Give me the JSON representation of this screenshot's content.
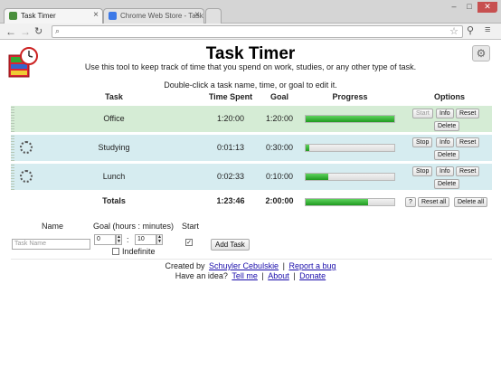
{
  "browser": {
    "tabs": [
      {
        "label": "Task Timer",
        "active": true
      },
      {
        "label": "Chrome Web Store - Task",
        "active": false
      }
    ],
    "address": ""
  },
  "page": {
    "title": "Task Timer",
    "subtitle": "Use this tool to keep track of time that you spend on work, studies, or any other type of task.",
    "hint": "Double-click a task name, time, or goal to edit it."
  },
  "columns": {
    "task": "Task",
    "time_spent": "Time Spent",
    "goal": "Goal",
    "progress": "Progress",
    "options": "Options"
  },
  "tasks": [
    {
      "name": "Office",
      "time": "1:20:00",
      "goal": "1:20:00",
      "progress": 1.0,
      "running": false,
      "btn_start": "Start",
      "btn_info": "Info",
      "btn_reset": "Reset",
      "btn_delete": "Delete"
    },
    {
      "name": "Studying",
      "time": "0:01:13",
      "goal": "0:30:00",
      "progress": 0.04,
      "running": true,
      "btn_start": "Stop",
      "btn_info": "Info",
      "btn_reset": "Reset",
      "btn_delete": "Delete"
    },
    {
      "name": "Lunch",
      "time": "0:02:33",
      "goal": "0:10:00",
      "progress": 0.25,
      "running": true,
      "btn_start": "Stop",
      "btn_info": "Info",
      "btn_reset": "Reset",
      "btn_delete": "Delete"
    }
  ],
  "totals": {
    "label": "Totals",
    "time": "1:23:46",
    "goal": "2:00:00",
    "progress": 0.7,
    "btn_help": "?",
    "btn_reset_all": "Reset all",
    "btn_delete_all": "Delete all"
  },
  "form": {
    "name_label": "Name",
    "goal_label": "Goal (hours : minutes)",
    "start_label": "Start",
    "name_placeholder": "Task Name",
    "hours": "0",
    "colon": ":",
    "minutes": "10",
    "indefinite_label": "Indefinite",
    "start_checked": true,
    "add_button": "Add Task"
  },
  "footer": {
    "created_by": "Created by",
    "author": "Schuyler Cebulskie",
    "pipe1": "|",
    "report": "Report a bug",
    "idea": "Have an idea?",
    "tell": "Tell me",
    "pipe2": "|",
    "about": "About",
    "pipe3": "|",
    "donate": "Donate"
  },
  "colors": {
    "finished_row": "#d5ecd5",
    "running_row": "#d6ecf0",
    "progress_fill": "#2fb52f"
  }
}
